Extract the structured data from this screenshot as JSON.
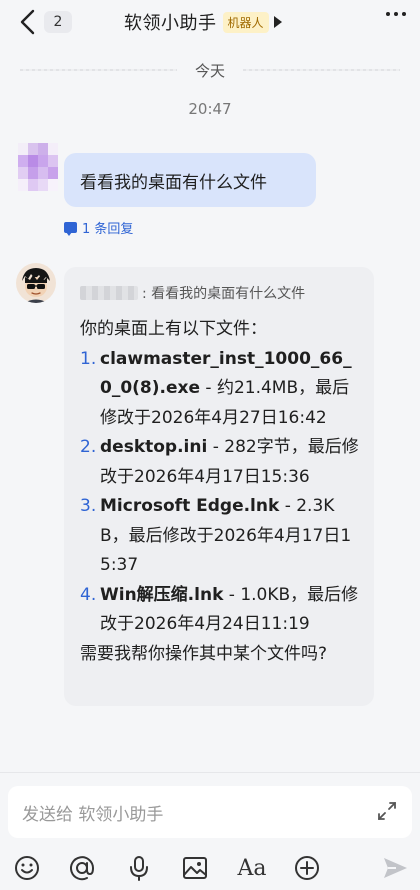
{
  "header": {
    "unread_count": "2",
    "title": "软领小助手",
    "badge": "机器人"
  },
  "chat": {
    "date_label": "今天",
    "time_label": "20:47",
    "user_message": "看看我的桌面有什么文件",
    "reply_link": "1 条回复",
    "bot_message": {
      "quote_text": ": 看看我的桌面有什么文件",
      "intro": "你的桌面上有以下文件：",
      "files": [
        {
          "num": "1.",
          "name": "clawmaster_inst_1000_66_0_0(8).exe",
          "detail": " - 约21.4MB，最后修改于2026年4月27日16:42"
        },
        {
          "num": "2.",
          "name": "desktop.ini",
          "detail": " - 282字节，最后修改于2026年4月17日15:36"
        },
        {
          "num": "3.",
          "name": "Microsoft Edge.lnk",
          "detail": " - 2.3KB，最后修改于2026年4月17日15:37"
        },
        {
          "num": "4.",
          "name": "Win解压缩.lnk",
          "detail": " - 1.0KB，最后修改于2026年4月24日11:19"
        }
      ],
      "outro": "需要我帮你操作其中某个文件吗?"
    }
  },
  "input": {
    "placeholder": "发送给 软领小助手"
  },
  "toolbar": {
    "icons": [
      "emoji-icon",
      "mention-icon",
      "microphone-icon",
      "image-icon",
      "text-format-icon",
      "add-icon",
      "send-icon"
    ],
    "format_label": "Aa"
  },
  "colors": {
    "accent": "#2f64d4",
    "user_bubble": "#d9e4fb",
    "bot_bubble": "#eeeff2",
    "badge_bg": "#fdf1c7",
    "badge_text": "#a06a00"
  }
}
